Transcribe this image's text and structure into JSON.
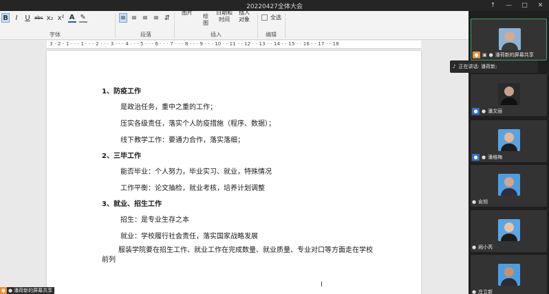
{
  "window": {
    "title": "20220427全体大会",
    "buttons": [
      "↑",
      "—",
      "□",
      "✕"
    ]
  },
  "ribbon": {
    "font_icons": [
      "B",
      "I",
      "U",
      "abc",
      "x₂",
      "x²",
      "A",
      "✎"
    ],
    "para_icons": [
      "≡",
      "≡",
      "≡",
      "≡",
      "⇵"
    ],
    "insert_items": [
      "图片",
      "绘图",
      "日期和时间",
      "插入对象"
    ],
    "select_all": "全选",
    "groups": [
      "字体",
      "段落",
      "插入",
      "编辑"
    ]
  },
  "ruler": "3 · 2 · 1 · · · 1 · · · 2 · · · 3 · · · 4 · · · 5 · · · 6 · · · 7 · · · 8 · · · 9 · · · 10 · · 11 · · 12 · · 13 · · 14 · · 15 · · 16 · · 17 · · 18",
  "document": {
    "s1_title": "1、防疫工作",
    "s1_l1": "是政治任务，重中之重的工作；",
    "s1_l2": "压实各级责任，落实个人防疫措施（程序、数据）；",
    "s1_l3": "线下教学工作：要通力合作，落实落细；",
    "s2_title": "2、三毕工作",
    "s2_l1": "能否毕业：个人努力，毕业实习、就业，特殊情况",
    "s2_l2": "工作平衡：论文抽检，就业考核，培养计划调整",
    "s3_title": "3、就业、招生工作",
    "s3_l1": "招生：是专业生存之本",
    "s3_l2": "就业：学校履行社会责任，落实国家战略发展",
    "s3_para": "服装学院要在招生工作、就业工作在完成数量、就业质量、专业对口等方面走在学校前列"
  },
  "share_tag": "潘荷新的屏幕共享",
  "speaking": "正在讲话: 潘荷新;",
  "participants": [
    {
      "name": "潘荷新的屏幕共享",
      "shirt": "#3a3a3a",
      "bg": "#8fb3d6",
      "skin": "#d9a98a"
    },
    {
      "name": "潘文丽",
      "shirt": "#111111",
      "bg": "#2a2a2a",
      "skin": "#c9a08a"
    },
    {
      "name": "潘维梅",
      "shirt": "#1d1d1d",
      "bg": "#5aa3e0",
      "skin": "#e5b899"
    },
    {
      "name": "俞旭",
      "shirt": "#2e2e3e",
      "bg": "#4d9ee0",
      "skin": "#d9a58a"
    },
    {
      "name": "阙小芮",
      "shirt": "#1b1b1b",
      "bg": "#5ba5e2",
      "skin": "#e8c3a8"
    },
    {
      "name": "庄立新",
      "shirt": "#2b2b36",
      "bg": "#4d9ee0",
      "skin": "#c8916e"
    }
  ],
  "colors": {
    "share_orange": "#f38d2c",
    "badge_blue": "#2f6fd0",
    "active_green": "#3fa06a"
  }
}
